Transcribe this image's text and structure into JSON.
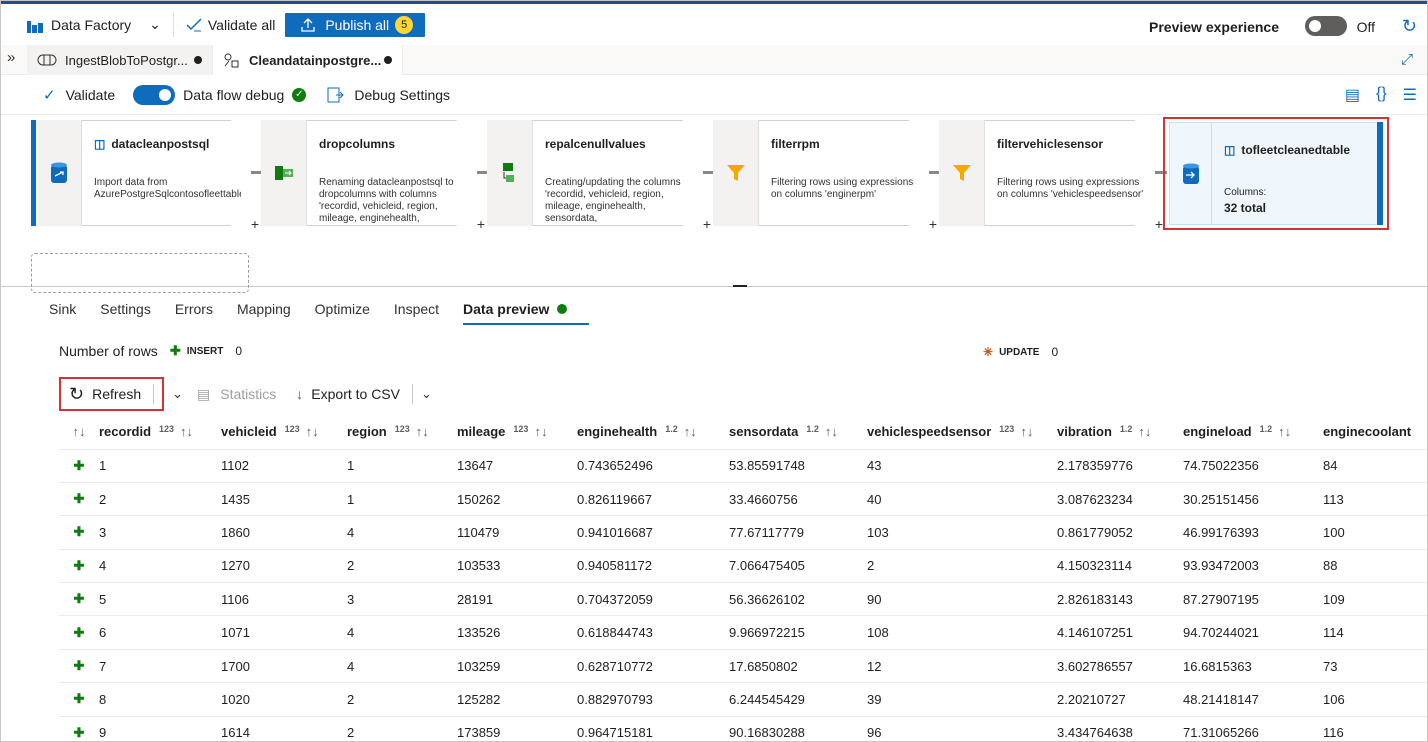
{
  "topbar": {
    "factory_label": "Data Factory",
    "validate_all": "Validate all",
    "publish_all": "Publish all",
    "publish_count": "5",
    "preview_experience": "Preview experience",
    "preview_state": "Off"
  },
  "tabs": [
    {
      "label": "IngestBlobToPostgr..."
    },
    {
      "label": "Cleandatainpostgre..."
    }
  ],
  "toolbar2": {
    "validate": "Validate",
    "debug_label": "Data flow debug",
    "debug_settings": "Debug Settings"
  },
  "nodes": [
    {
      "title": "datacleanpostsql",
      "desc": "Import data from AzurePostgreSqlcontosofleettable"
    },
    {
      "title": "dropcolumns",
      "desc": "Renaming datacleanpostsql to dropcolumns with columns 'recordid, vehicleid, region, mileage, enginehealth,"
    },
    {
      "title": "repalcenullvalues",
      "desc": "Creating/updating the columns 'recordid, vehicleid, region, mileage, enginehealth, sensordata,"
    },
    {
      "title": "filterrpm",
      "desc": "Filtering rows using expressions on columns 'enginerpm'"
    },
    {
      "title": "filtervehiclesensor",
      "desc": "Filtering rows using expressions on columns 'vehiclespeedsensor'"
    }
  ],
  "sink": {
    "title": "tofleetcleanedtable",
    "columns_label": "Columns:",
    "columns_total": "32 total"
  },
  "subtabs": [
    "Sink",
    "Settings",
    "Errors",
    "Mapping",
    "Optimize",
    "Inspect",
    "Data preview"
  ],
  "stats": {
    "rows_label": "Number of rows",
    "insert_label": "INSERT",
    "insert_count": "0",
    "update_label": "UPDATE",
    "update_count": "0"
  },
  "data_toolbar": {
    "refresh": "Refresh",
    "statistics": "Statistics",
    "export": "Export to CSV"
  },
  "columns": [
    {
      "name": "recordid",
      "type": "123"
    },
    {
      "name": "vehicleid",
      "type": "123"
    },
    {
      "name": "region",
      "type": "123"
    },
    {
      "name": "mileage",
      "type": "123"
    },
    {
      "name": "enginehealth",
      "type": "1.2"
    },
    {
      "name": "sensordata",
      "type": "1.2"
    },
    {
      "name": "vehiclespeedsensor",
      "type": "123"
    },
    {
      "name": "vibration",
      "type": "1.2"
    },
    {
      "name": "engineload",
      "type": "1.2"
    },
    {
      "name": "enginecoolant",
      "type": ""
    }
  ],
  "rows": [
    [
      "1",
      "1102",
      "1",
      "13647",
      "0.743652496",
      "53.85591748",
      "43",
      "2.178359776",
      "74.75022356",
      "84"
    ],
    [
      "2",
      "1435",
      "1",
      "150262",
      "0.826119667",
      "33.4660756",
      "40",
      "3.087623234",
      "30.25151456",
      "113"
    ],
    [
      "3",
      "1860",
      "4",
      "110479",
      "0.941016687",
      "77.67117779",
      "103",
      "0.861779052",
      "46.99176393",
      "100"
    ],
    [
      "4",
      "1270",
      "2",
      "103533",
      "0.940581172",
      "7.066475405",
      "2",
      "4.150323114",
      "93.93472003",
      "88"
    ],
    [
      "5",
      "1106",
      "3",
      "28191",
      "0.704372059",
      "56.36626102",
      "90",
      "2.826183143",
      "87.27907195",
      "109"
    ],
    [
      "6",
      "1071",
      "4",
      "133526",
      "0.618844743",
      "9.966972215",
      "108",
      "4.146107251",
      "94.70244021",
      "114"
    ],
    [
      "7",
      "1700",
      "4",
      "103259",
      "0.628710772",
      "17.6850802",
      "12",
      "3.602786557",
      "16.6815363",
      "73"
    ],
    [
      "8",
      "1020",
      "2",
      "125282",
      "0.882970793",
      "6.244545429",
      "39",
      "2.20210727",
      "48.21418147",
      "106"
    ],
    [
      "9",
      "1614",
      "2",
      "173859",
      "0.964715181",
      "90.16830288",
      "96",
      "3.434764638",
      "71.31065266",
      "116"
    ]
  ]
}
